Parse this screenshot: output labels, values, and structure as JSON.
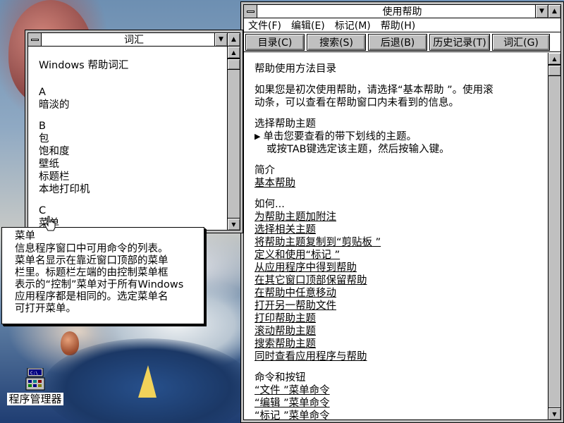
{
  "help_window": {
    "title": "使用帮助",
    "menus": [
      "文件(F)",
      "编辑(E)",
      "标记(M)",
      "帮助(H)"
    ],
    "buttons": [
      "目录(C)",
      "搜索(S)",
      "后退(B)",
      "历史记录(T)",
      "词汇(G)"
    ],
    "heading": "帮助使用方法目录",
    "intro": [
      "如果您是初次使用帮助，请选择“基本帮助 ”。使用滚",
      "动条，可以查看在帮助窗口内未看到的信息。"
    ],
    "select_title": "选择帮助主题",
    "select_line1": "单击您要查看的带下划线的主题。",
    "select_line2": "或按TAB键选定该主题，然后按输入键。",
    "intro_section_title": "简介",
    "intro_link": "基本帮助",
    "howto_title": "如何...",
    "howto_links": [
      "为帮助主题加附注",
      "选择相关主题",
      "将帮助主题复制到“剪贴板 ”",
      "定义和使用“标记 ”",
      "从应用程序中得到帮助",
      "在其它窗口顶部保留帮助",
      "在帮助中任意移动",
      "打开另一帮助文件",
      "打印帮助主题",
      "滚动帮助主题",
      "搜索帮助主题",
      "同时查看应用程序与帮助"
    ],
    "commands_title": "命令和按钮",
    "command_links": [
      "“文件 ”菜单命令",
      "“编辑 ”菜单命令",
      "“标记 ”菜单命令"
    ]
  },
  "glossary_window": {
    "title": "词汇",
    "heading": "Windows 帮助词汇",
    "sections": [
      {
        "letter": "A",
        "terms": [
          "暗淡的"
        ]
      },
      {
        "letter": "B",
        "terms": [
          "包",
          "饱和度",
          "壁纸",
          "标题栏",
          "本地打印机"
        ]
      },
      {
        "letter": "C",
        "terms": [
          "菜单"
        ]
      }
    ]
  },
  "popup": {
    "title": "菜单",
    "lines": [
      "信息程序窗口中可用命令的列表。",
      "菜单名显示在靠近窗口顶部的菜单",
      "栏里。标题栏左端的由控制菜单框",
      "表示的“控制”菜单对于所有Windows",
      "应用程序都是相同的。选定菜单名",
      "可打开菜单。"
    ]
  },
  "desktop": {
    "program_manager_label": "程序管理器"
  },
  "icons": {
    "system_menu": "system-menu-icon",
    "minimize": "minimize-arrow-icon",
    "maximize": "maximize-arrow-icon",
    "bullet": "triangle-bullet-icon",
    "pointer": "hand-pointer-icon"
  }
}
